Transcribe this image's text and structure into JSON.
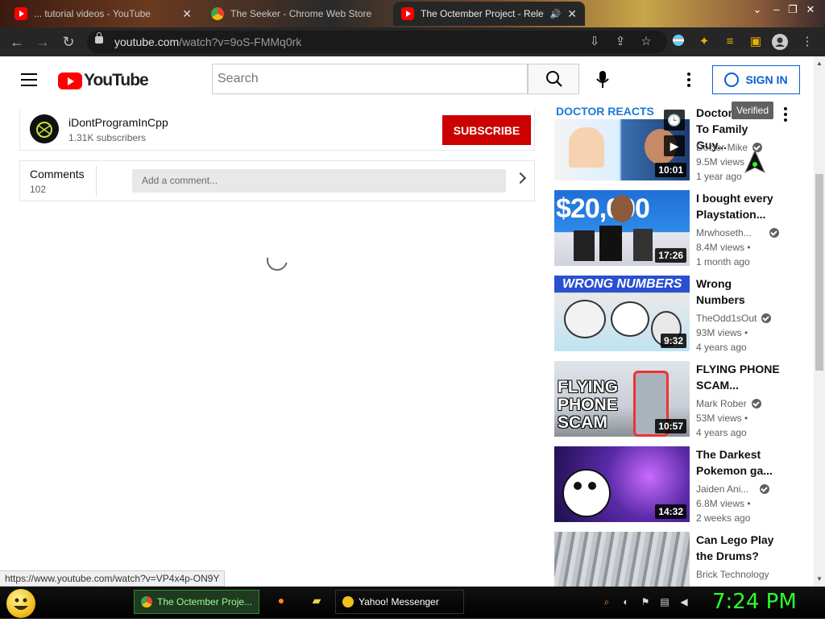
{
  "browser": {
    "tabs": [
      {
        "title": "... tutorial videos - YouTube",
        "favicon": "youtube-icon"
      },
      {
        "title": "The Seeker - Chrome Web Store",
        "favicon": "chrome-web-store-icon"
      },
      {
        "title": "The Octember Project - Rele",
        "favicon": "youtube-icon",
        "active": true
      }
    ],
    "url_host": "youtube.com",
    "url_path": "/watch?v=9oS-FMMq0rk",
    "status_url": "https://www.youtube.com/watch?v=VP4x4p-ON9Y"
  },
  "youtube": {
    "logo_text": "YouTube",
    "search_placeholder": "Search",
    "sign_in_label": "SIGN IN",
    "channel": {
      "name": "iDontProgramInCpp",
      "subscribers": "1.31K subscribers",
      "subscribe_label": "SUBSCRIBE"
    },
    "comments": {
      "title": "Comments",
      "count": "102",
      "placeholder": "Add a comment..."
    },
    "tooltip": "Verified",
    "recommendations": [
      {
        "title": "Doctor ... To Family Guy...",
        "title_l1": "Doctor",
        "title_l2": "To Family Guy...",
        "channel": "Doctor Mike",
        "views": "9.5M views",
        "age": "1 year ago",
        "duration": "10:01",
        "thumb_text": "DOCTOR REACTS"
      },
      {
        "title_l1": "I bought every",
        "title_l2": "Playstation...",
        "channel": "Mrwhoseth...",
        "views": "8.4M views •",
        "age": "1 month ago",
        "duration": "17:26",
        "thumb_text": "$20,000"
      },
      {
        "title_l1": "Wrong",
        "title_l2": "Numbers",
        "channel": "TheOdd1sOut",
        "views": "93M views •",
        "age": "4 years ago",
        "duration": "9:32",
        "thumb_text": "WRONG NUMBERS"
      },
      {
        "title_l1": "FLYING PHONE",
        "title_l2": "SCAM...",
        "channel": "Mark Rober",
        "views": "53M views •",
        "age": "4 years ago",
        "duration": "10:57",
        "thumb_text": "FLYING PHONE SCAM"
      },
      {
        "title_l1": "The Darkest",
        "title_l2": "Pokemon ga...",
        "channel": "Jaiden Ani...",
        "views": "6.8M views •",
        "age": "2 weeks ago",
        "duration": "14:32",
        "thumb_text": ""
      },
      {
        "title_l1": "Can Lego Play",
        "title_l2": "the Drums?",
        "channel": "Brick Technology",
        "views": "",
        "age": "",
        "duration": "",
        "thumb_text": ""
      }
    ]
  },
  "taskbar": {
    "tasks": [
      "The Octember Proje...",
      "Yahoo! Messenger"
    ],
    "clock": "7:24 PM"
  }
}
